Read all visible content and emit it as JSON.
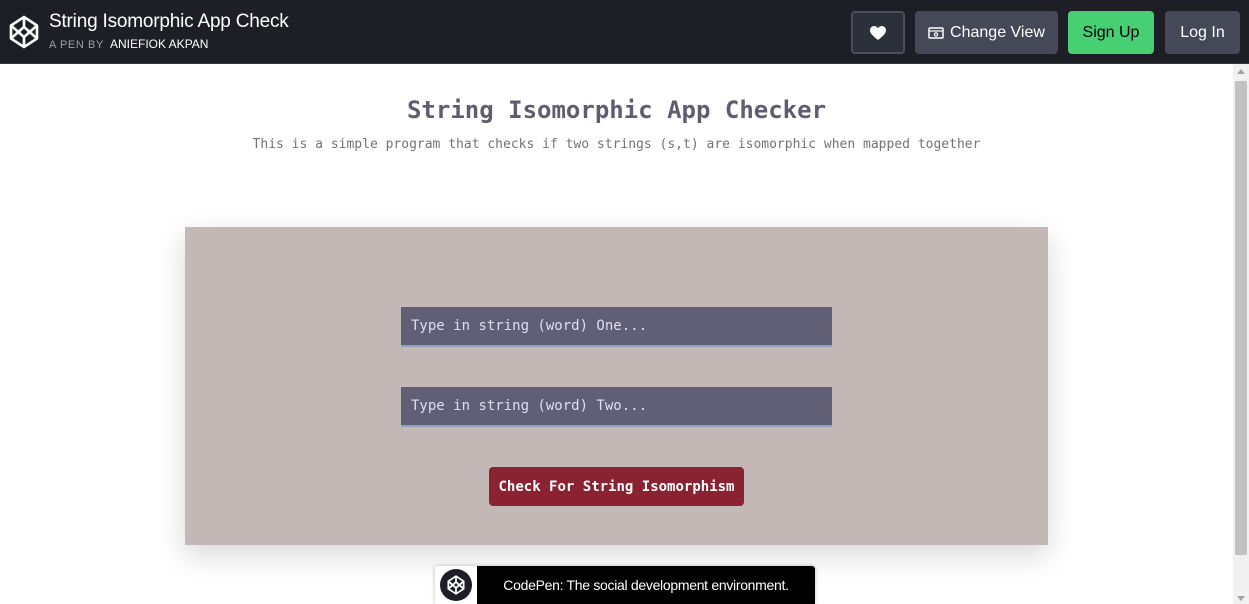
{
  "header": {
    "pen_title": "String Isomorphic App Check",
    "pen_by_label": "A PEN BY",
    "author": "ANIEFIOK AKPAN",
    "change_view_label": "Change View",
    "signup_label": "Sign Up",
    "login_label": "Log In"
  },
  "app": {
    "title": "String Isomorphic App Checker",
    "subtitle": "This is a simple program that checks if two strings (s,t) are isomorphic when mapped together",
    "input_one_placeholder": "Type in string (word) One...",
    "input_one_value": "",
    "input_two_placeholder": "Type in string (word) Two...",
    "input_two_value": "",
    "check_button_label": "Check For String Isomorphism"
  },
  "badge": {
    "text": "CodePen: The social development environment."
  },
  "colors": {
    "topbar": "#1e1f26",
    "signup": "#47cf73",
    "card": "#c4b8b6",
    "input": "#615f75",
    "check_button": "#8b2231"
  }
}
